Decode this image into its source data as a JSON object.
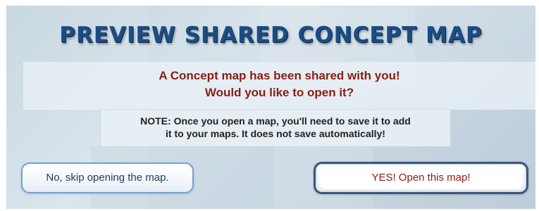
{
  "dialog": {
    "title": "PREVIEW SHARED CONCEPT MAP",
    "message_line1": "A Concept map has been shared with you!",
    "message_line2": "Would you like to open it?",
    "note_line1": "NOTE: Once you open a map, you'll need to save it to add",
    "note_line2": "it to your maps. It does not save automatically!",
    "buttons": {
      "skip_label": "No, skip opening the map.",
      "open_label": "YES! Open this map!"
    }
  },
  "colors": {
    "title": "#1b4d84",
    "message": "#8a1d12",
    "note": "#222222",
    "skip_button_border": "#6fa3d6",
    "open_button_border": "#3a567a"
  }
}
